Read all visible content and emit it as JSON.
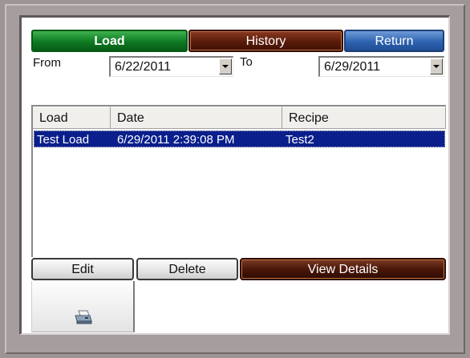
{
  "tabs": {
    "load": "Load",
    "history": "History",
    "return": "Return"
  },
  "filter": {
    "from_label": "From",
    "from_value": "6/22/2011",
    "to_label": "To",
    "to_value": "6/29/2011"
  },
  "table": {
    "columns": [
      "Load",
      "Date",
      "Recipe"
    ],
    "rows": [
      {
        "load": "Test Load",
        "date": "6/29/2011 2:39:08 PM",
        "recipe": "Test2"
      }
    ]
  },
  "actions": {
    "edit": "Edit",
    "delete": "Delete",
    "view_details": "View Details"
  },
  "icons": {
    "print": "printer-icon"
  },
  "colors": {
    "tab_load": "#0e7a22",
    "tab_history": "#5a1c0a",
    "tab_return": "#2f63b0",
    "selected_row": "#0a1f8c",
    "view_details": "#4b1708"
  }
}
